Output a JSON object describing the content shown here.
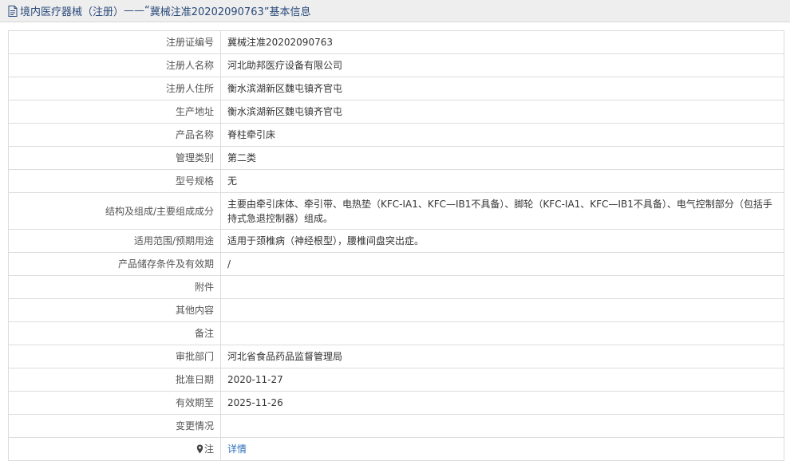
{
  "header": {
    "category": "境内医疗器械（注册）",
    "separator": " ——“",
    "reg_no": "冀械注准20202090763",
    "suffix": "”基本信息"
  },
  "rows": [
    {
      "label": "注册证编号",
      "value": "冀械注准20202090763"
    },
    {
      "label": "注册人名称",
      "value": "河北助邦医疗设备有限公司"
    },
    {
      "label": "注册人住所",
      "value": "衡水滨湖新区魏屯镇齐官屯"
    },
    {
      "label": "生产地址",
      "value": "衡水滨湖新区魏屯镇齐官屯"
    },
    {
      "label": "产品名称",
      "value": "脊柱牵引床"
    },
    {
      "label": "管理类别",
      "value": "第二类"
    },
    {
      "label": "型号规格",
      "value": "无"
    },
    {
      "label": "结构及组成/主要组成成分",
      "value": "主要由牵引床体、牵引带、电热垫（KFC-ⅠA1、KFC—ⅠB1不具备）、脚轮（KFC-ⅠA1、KFC—ⅠB1不具备）、电气控制部分（包括手持式急退控制器）组成。"
    },
    {
      "label": "适用范围/预期用途",
      "value": "适用于颈椎病（神经根型），腰椎间盘突出症。"
    },
    {
      "label": "产品储存条件及有效期",
      "value": "/"
    },
    {
      "label": "附件",
      "value": ""
    },
    {
      "label": "其他内容",
      "value": ""
    },
    {
      "label": "备注",
      "value": ""
    },
    {
      "label": "审批部门",
      "value": "河北省食品药品监督管理局"
    },
    {
      "label": "批准日期",
      "value": "2020-11-27"
    },
    {
      "label": "有效期至",
      "value": "2025-11-26"
    },
    {
      "label": "变更情况",
      "value": ""
    }
  ],
  "note": {
    "label": "注",
    "link_text": "详情"
  },
  "colors": {
    "header_bg": "#eeeeee",
    "header_text": "#2a4a7a",
    "link": "#2a6ebb",
    "border": "#dcdcdc"
  }
}
